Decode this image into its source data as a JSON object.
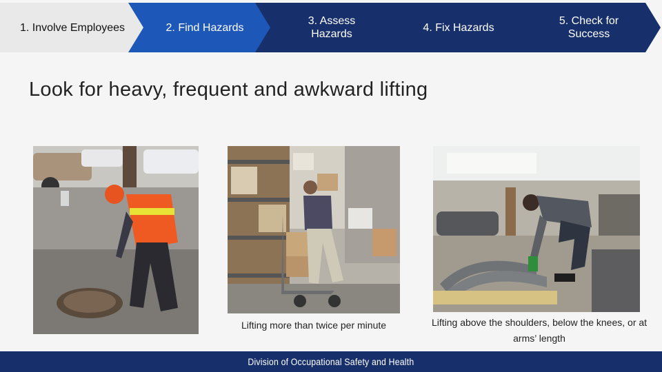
{
  "steps": [
    {
      "label": "1. Involve Employees",
      "state": "inactive"
    },
    {
      "label": "2. Find Hazards",
      "state": "active"
    },
    {
      "label": "3. Assess Hazards",
      "state": "dark"
    },
    {
      "label": "4. Fix Hazards",
      "state": "dark"
    },
    {
      "label": "5. Check for Success",
      "state": "dark"
    }
  ],
  "title": "Look for heavy, frequent and awkward lifting",
  "photos": [
    {
      "caption": "",
      "icon": "worker-lifting-manhole-cover-photo"
    },
    {
      "caption": "Lifting more than twice per minute",
      "icon": "warehouse-hand-truck-photo"
    },
    {
      "caption": "Lifting above the shoulders, below the knees, or at arms’ length",
      "icon": "worker-lifting-pipes-photo"
    }
  ],
  "footer": {
    "text": "Division of Occupational Safety and Health"
  },
  "colors": {
    "navy": "#17306b",
    "active": "#1d58b8",
    "inactive": "#e9e9e9"
  }
}
